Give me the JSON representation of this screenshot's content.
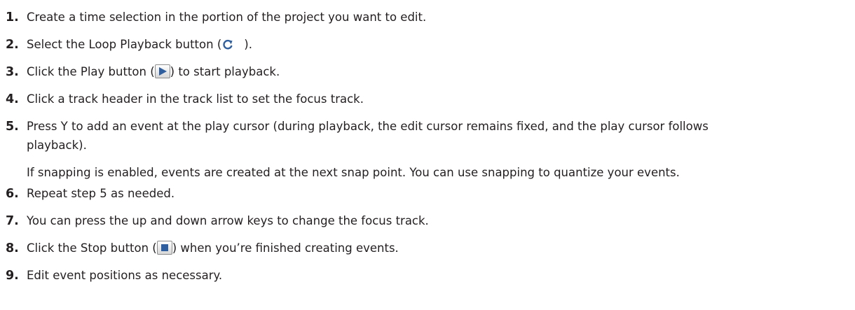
{
  "steps": [
    {
      "num": "1.",
      "text": "Create a time selection in the portion of the project you want to edit."
    },
    {
      "num": "2.",
      "before": "Select the Loop Playback button (",
      "after": ")."
    },
    {
      "num": "3.",
      "before": "Click the Play button (",
      "after": ") to start playback."
    },
    {
      "num": "4.",
      "text": "Click a track header in the track list to set the focus track."
    },
    {
      "num": "5.",
      "text": "Press Y to add an event at the play cursor (during playback, the edit cursor remains fixed, and the play cursor follows",
      "text2": "playback)."
    },
    {
      "num": "6.",
      "text": "Repeat step 5 as needed."
    },
    {
      "num": "7.",
      "text": "You can press the up and down arrow keys to change the focus track."
    },
    {
      "num": "8.",
      "before": "Click the Stop button (",
      "after": ") when you’re finished creating events."
    },
    {
      "num": "9.",
      "text": "Edit event positions as necessary."
    }
  ],
  "note": "If snapping is enabled, events are created at the next snap point. You can use snapping to quantize your events.",
  "icons": {
    "loop": "loop-playback-icon",
    "play": "play-icon",
    "stop": "stop-icon",
    "accent_color": "#2f5f9f"
  }
}
